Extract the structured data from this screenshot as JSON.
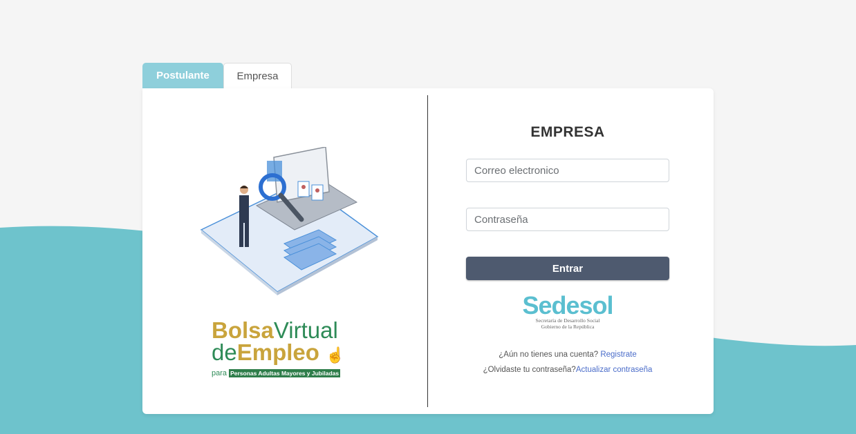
{
  "tabs": [
    {
      "label": "Postulante",
      "active": true
    },
    {
      "label": "Empresa",
      "active": false
    }
  ],
  "form": {
    "title": "EMPRESA",
    "email_placeholder": "Correo electronico",
    "password_placeholder": "Contraseña",
    "submit_label": "Entrar"
  },
  "links": {
    "register_prompt": "¿Aún no tienes una cuenta?",
    "register_link": "Registrate",
    "forgot_prompt": "¿Olvidaste tu contraseña?",
    "forgot_link": "Actualizar contraseña"
  },
  "logos": {
    "bolsa": {
      "line1a": "Bolsa",
      "line1b": "Virtual",
      "line2a": "de",
      "line2b": "Empleo",
      "line3a": "para",
      "line3b": "Personas Adultas Mayores y Jubiladas"
    },
    "sedesol": {
      "name": "Sedesol",
      "subtitle1": "Secretaría de Desarrollo Social",
      "subtitle2": "Gobierno de la República"
    }
  },
  "colors": {
    "teal": "#6ec3cc",
    "tab_active": "#8ecfdb",
    "button": "#4e5a6f",
    "link": "#4a6cc9",
    "gold": "#c9a43c",
    "green": "#2e8b57"
  }
}
